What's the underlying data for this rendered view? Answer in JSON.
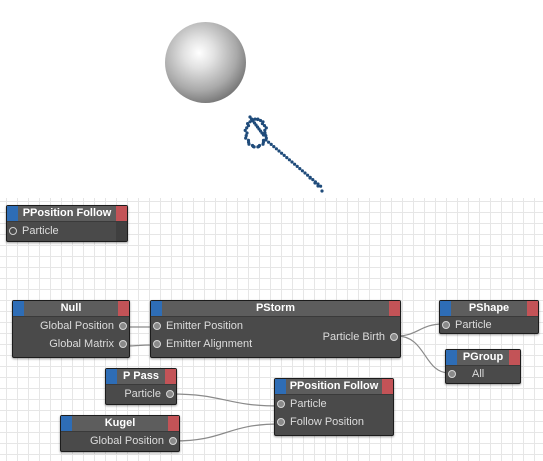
{
  "colors": {
    "node_body": "#4a4a4a",
    "node_header": "#5d5d5d",
    "input_tab": "#2e6db6",
    "output_tab": "#c35357",
    "wire": "#8a8a8a",
    "particle": "#1f4b7a"
  },
  "viewport": {
    "object": "sphere",
    "particle_stream": "particle-trail"
  },
  "nodes": {
    "pposition_follow_top": {
      "title": "PPosition Follow",
      "port_particle": "Particle"
    },
    "null": {
      "title": "Null",
      "port_global_position": "Global Position",
      "port_global_matrix": "Global Matrix"
    },
    "pstorm": {
      "title": "PStorm",
      "port_emitter_position": "Emitter Position",
      "port_emitter_alignment": "Emitter Alignment",
      "port_particle_birth": "Particle Birth"
    },
    "pshape": {
      "title": "PShape",
      "port_particle": "Particle"
    },
    "pgroup": {
      "title": "PGroup",
      "port_all": "All"
    },
    "ppass": {
      "title": "P Pass",
      "port_particle": "Particle"
    },
    "pposition_follow": {
      "title": "PPosition Follow",
      "port_particle": "Particle",
      "port_follow_position": "Follow Position"
    },
    "kugel": {
      "title": "Kugel",
      "port_global_position": "Global Position"
    }
  },
  "connections": [
    [
      "Null.Global Position",
      "PStorm.Emitter Position"
    ],
    [
      "Null.Global Matrix",
      "PStorm.Emitter Alignment"
    ],
    [
      "PStorm.Particle Birth",
      "PShape.Particle"
    ],
    [
      "PStorm.Particle Birth",
      "PGroup.All"
    ],
    [
      "P Pass.Particle",
      "PPosition Follow.Particle"
    ],
    [
      "Kugel.Global Position",
      "PPosition Follow.Follow Position"
    ]
  ]
}
